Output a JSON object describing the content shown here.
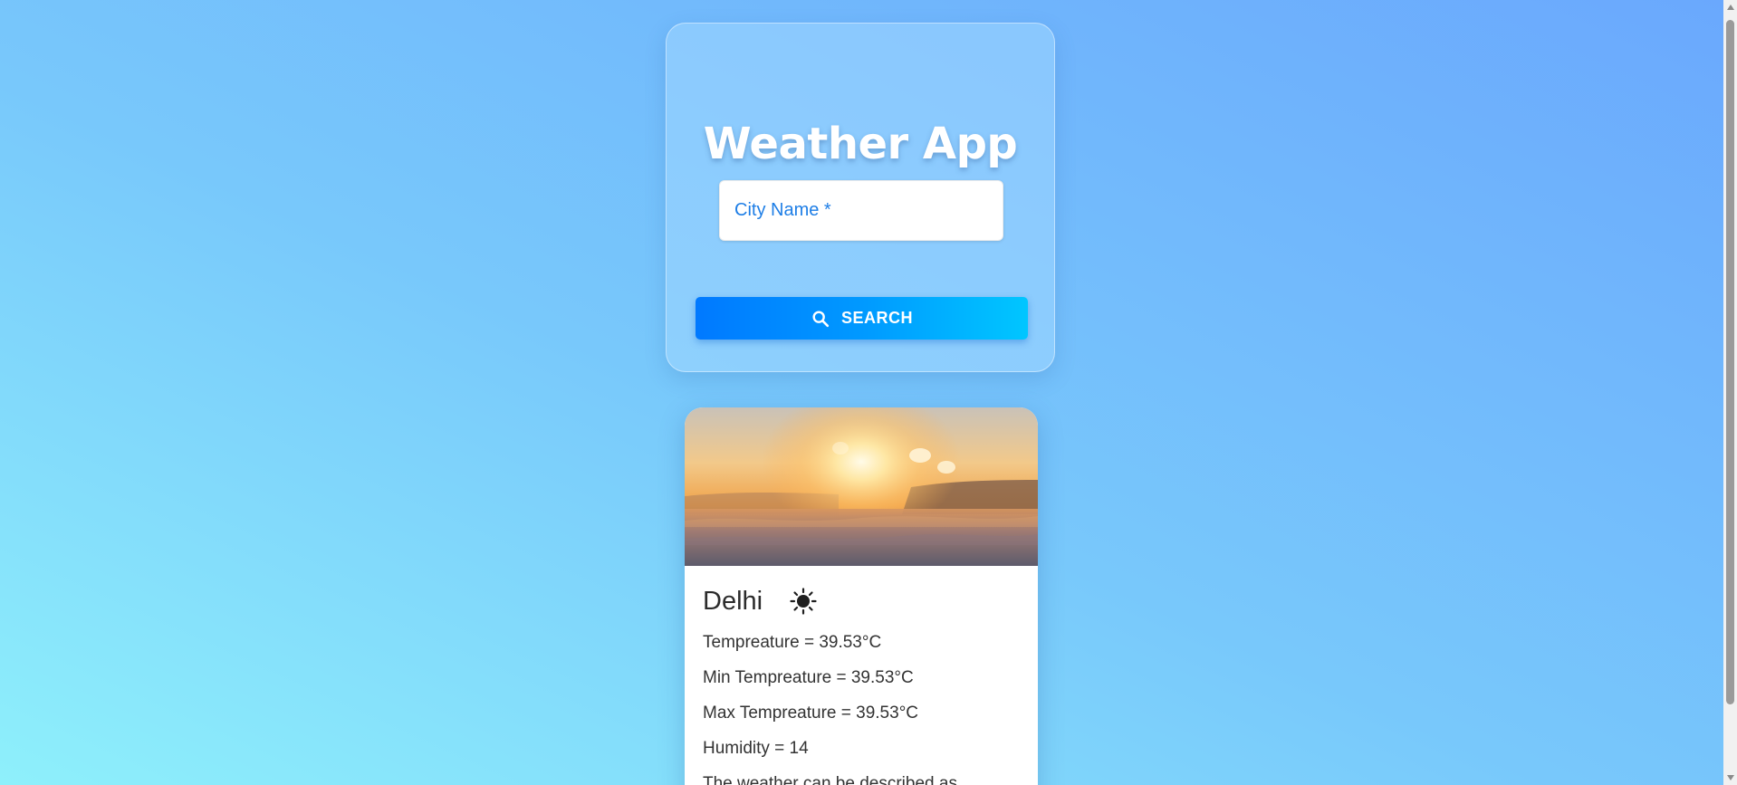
{
  "app": {
    "title": "Weather App"
  },
  "search": {
    "placeholder": "City Name *",
    "value": "",
    "button_label": "SEARCH",
    "button_icon": "search-icon"
  },
  "weather": {
    "image": "sunrise-over-clouds",
    "city": "Delhi",
    "condition_icon": "sun-icon",
    "temperature": "Tempreature = 39.53°C",
    "min_temperature": "Min Tempreature = 39.53°C",
    "max_temperature": "Max Tempreature = 39.53°C",
    "humidity": "Humidity = 14",
    "description": "The weather can be described as"
  },
  "colors": {
    "background_top_right": "#6aa8fd",
    "background_bottom_left": "#8ef0fb",
    "button_gradient_start": "#0079ff",
    "button_gradient_end": "#00c6ff",
    "input_text": "#1e7ee6"
  }
}
